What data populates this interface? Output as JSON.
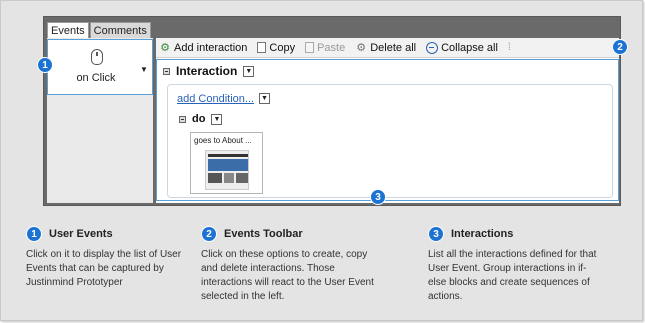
{
  "tabs": [
    {
      "label": "Events",
      "active": true
    },
    {
      "label": "Comments",
      "active": false
    }
  ],
  "event": {
    "label": "on Click",
    "icon": "mouse-icon"
  },
  "toolbar": {
    "add_interaction": "Add interaction",
    "copy": "Copy",
    "paste": "Paste",
    "delete_all": "Delete all",
    "collapse_all": "Collapse all"
  },
  "interaction": {
    "title": "Interaction",
    "add_condition": "add Condition...",
    "do_label": "do",
    "action_text": "goes to About ..."
  },
  "badges": {
    "one": "1",
    "two": "2",
    "three": "3"
  },
  "legend": [
    {
      "number": "1",
      "title": "User Events",
      "desc_lines": [
        "Click on it to display the list of User",
        "Events that can be captured by",
        "Justinmind Prototyper"
      ]
    },
    {
      "number": "2",
      "title": "Events Toolbar",
      "desc_lines": [
        "Click on these options to create, copy",
        "and delete interactions. Those",
        "interactions will react to the User Event",
        "selected in the left."
      ]
    },
    {
      "number": "3",
      "title": "Interactions",
      "desc_lines": [
        "List all the interactions defined for that",
        "User Event. Group interactions in if-",
        "else blocks and create sequences of",
        "actions."
      ]
    }
  ],
  "colors": {
    "badge": "#1d73d4",
    "selection_border": "#5aa0d8",
    "link": "#2a62b8",
    "frame": "#6a6a6a"
  }
}
